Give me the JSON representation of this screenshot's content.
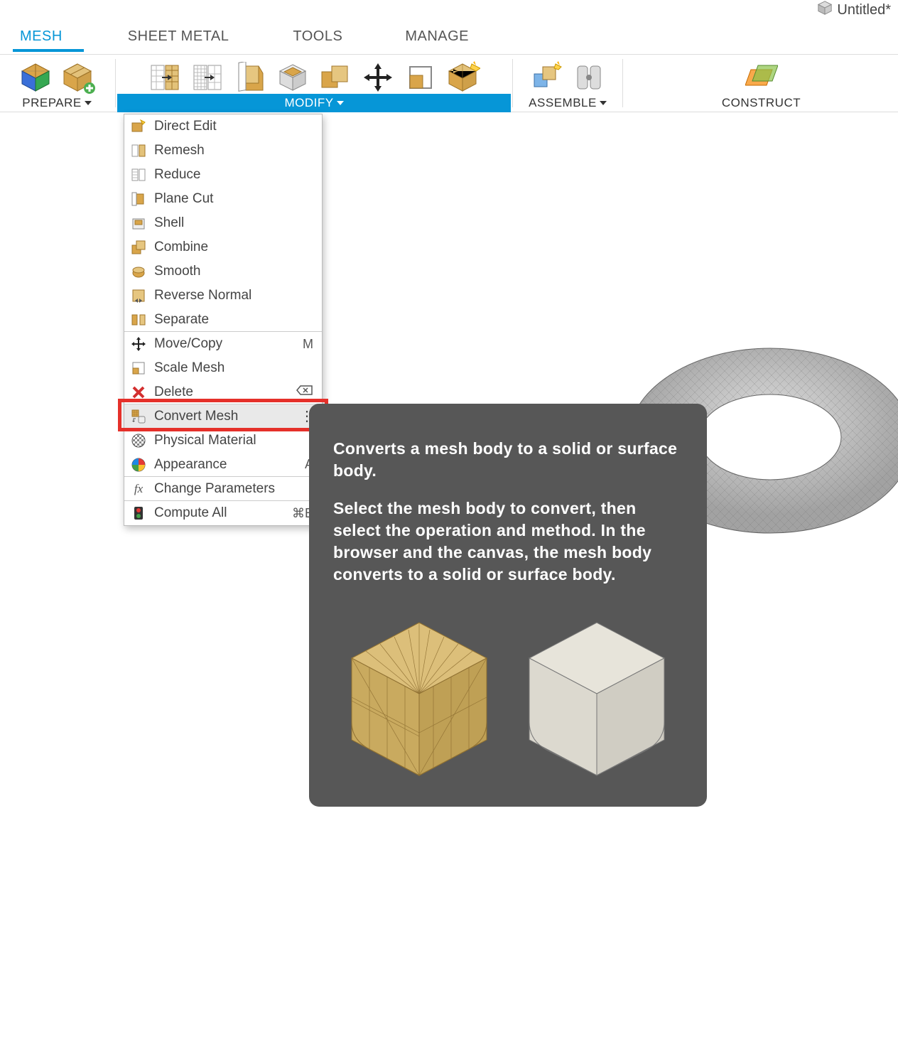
{
  "title": "Untitled*",
  "tabs": {
    "mesh": "MESH",
    "sheet_metal": "SHEET METAL",
    "tools": "TOOLS",
    "manage": "MANAGE"
  },
  "ribbon": {
    "prepare": "PREPARE",
    "modify": "MODIFY",
    "assemble": "ASSEMBLE",
    "construct": "CONSTRUCT"
  },
  "menu": {
    "direct_edit": "Direct Edit",
    "remesh": "Remesh",
    "reduce": "Reduce",
    "plane_cut": "Plane Cut",
    "shell": "Shell",
    "combine": "Combine",
    "smooth": "Smooth",
    "reverse_normal": "Reverse Normal",
    "separate": "Separate",
    "move_copy": "Move/Copy",
    "move_copy_short": "M",
    "scale_mesh": "Scale Mesh",
    "delete": "Delete",
    "convert_mesh": "Convert Mesh",
    "physical_material": "Physical Material",
    "appearance": "Appearance",
    "appearance_short": "A",
    "change_parameters": "Change Parameters",
    "compute_all": "Compute All",
    "compute_all_short": "⌘B"
  },
  "tooltip": {
    "p1": "Converts a mesh body to a solid or surface body.",
    "p2": "Select the mesh body to convert, then select the operation and method. In the browser and the canvas, the mesh body converts to a solid or surface body."
  }
}
